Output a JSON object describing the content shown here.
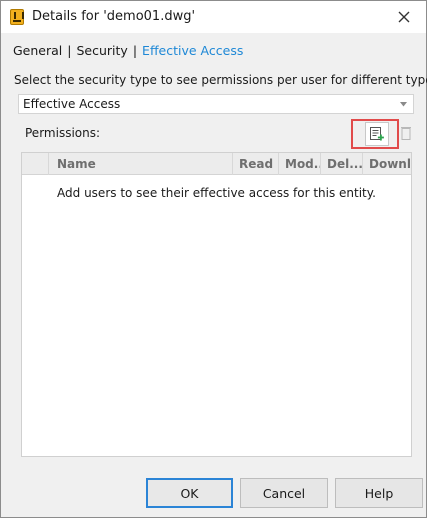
{
  "window": {
    "title": "Details for 'demo01.dwg'",
    "app_icon": "vault-app-icon",
    "close_icon": "close-icon"
  },
  "tabs": [
    {
      "label": "General"
    },
    {
      "label": "Security"
    },
    {
      "label": "Effective Access",
      "active": true
    }
  ],
  "tab_separator": "|",
  "instruction": "Select the security type to see permissions per user for different types:",
  "security_type": {
    "selected": "Effective Access"
  },
  "permissions": {
    "label": "Permissions:",
    "add_users_icon": "add-users-icon",
    "remove_icon": "remove-icon",
    "columns": [
      "",
      "Name",
      "Read",
      "Mod...",
      "Del...",
      "Downlo..."
    ],
    "empty_message": "Add users to see their effective access for this entity.",
    "rows": []
  },
  "buttons": {
    "ok": "OK",
    "cancel": "Cancel",
    "help": "Help"
  },
  "colors": {
    "accent": "#1e88d6",
    "highlight": "#e14b4b",
    "primary_border": "#2b84d6"
  }
}
